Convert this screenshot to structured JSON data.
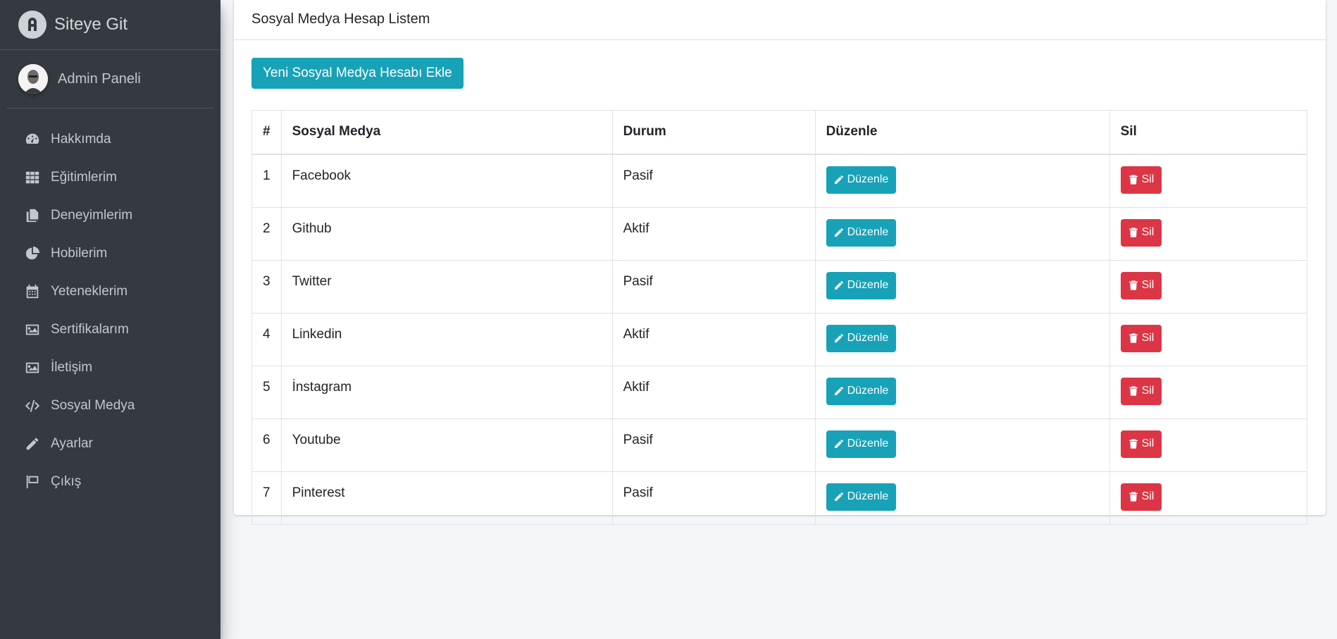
{
  "brand": {
    "title": "Siteye Git"
  },
  "user": {
    "name": "Admin Paneli"
  },
  "sidebar": {
    "items": [
      {
        "label": "Hakkımda",
        "icon": "tachometer-icon"
      },
      {
        "label": "Eğitimlerim",
        "icon": "grid-icon"
      },
      {
        "label": "Deneyimlerim",
        "icon": "copy-icon"
      },
      {
        "label": "Hobilerim",
        "icon": "chart-pie-icon"
      },
      {
        "label": "Yeteneklerim",
        "icon": "calendar-icon"
      },
      {
        "label": "Sertifikalarım",
        "icon": "image-icon"
      },
      {
        "label": "İletişim",
        "icon": "image-icon"
      },
      {
        "label": "Sosyal Medya",
        "icon": "code-icon"
      },
      {
        "label": "Ayarlar",
        "icon": "pencil-icon"
      },
      {
        "label": "Çıkış",
        "icon": "flag-icon"
      }
    ]
  },
  "card": {
    "title": "Sosyal Medya Hesap Listem",
    "add_button": "Yeni Sosyal Medya Hesabı Ekle"
  },
  "table": {
    "headers": {
      "num": "#",
      "name": "Sosyal Medya",
      "status": "Durum",
      "edit": "Düzenle",
      "delete": "Sil"
    },
    "edit_label": "Düzenle",
    "delete_label": "Sil",
    "rows": [
      {
        "num": "1",
        "name": "Facebook",
        "status": "Pasif"
      },
      {
        "num": "2",
        "name": "Github",
        "status": "Aktif"
      },
      {
        "num": "3",
        "name": "Twitter",
        "status": "Pasif"
      },
      {
        "num": "4",
        "name": "Linkedin",
        "status": "Aktif"
      },
      {
        "num": "5",
        "name": "İnstagram",
        "status": "Aktif"
      },
      {
        "num": "6",
        "name": "Youtube",
        "status": "Pasif"
      },
      {
        "num": "7",
        "name": "Pinterest",
        "status": "Pasif"
      }
    ]
  },
  "colors": {
    "sidebar_bg": "#343a40",
    "info": "#17a2b8",
    "danger": "#dc3545"
  }
}
